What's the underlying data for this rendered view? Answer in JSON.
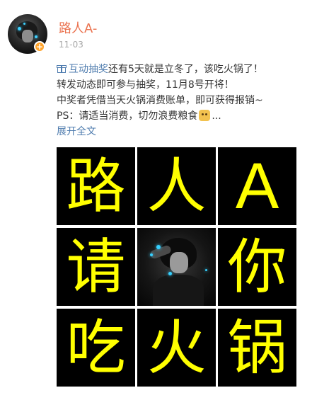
{
  "user": {
    "name": "路人A-",
    "timestamp": "11-03",
    "badge_glyph": "+"
  },
  "post": {
    "lottery_link_label": "互动抽奖",
    "line1_rest": "还有5天就是立冬了，该吃火锅了！",
    "line2": "转发动态即可参与抽奖，11月8号开将！",
    "line3": "中奖者凭借当天火锅消费账单，即可获得报销~",
    "line4_text": "PS：请适当消费，切勿浪费粮食",
    "line4_ellipsis": "...",
    "expand_label": "展开全文",
    "emoji_icon": "doge-emoji-icon"
  },
  "grid": {
    "tiles": [
      {
        "char": "路"
      },
      {
        "char": "人"
      },
      {
        "char": "A"
      },
      {
        "char": "请"
      },
      {
        "char": ""
      },
      {
        "char": "你"
      },
      {
        "char": "吃"
      },
      {
        "char": "火"
      },
      {
        "char": "锅"
      }
    ]
  },
  "colors": {
    "username": "#eb7350",
    "link": "#507daf",
    "body_text": "#333333",
    "timestamp": "#a8a8a8",
    "tile_bg": "#000000",
    "tile_text": "#ffff00",
    "badge": "#ffa42c"
  }
}
